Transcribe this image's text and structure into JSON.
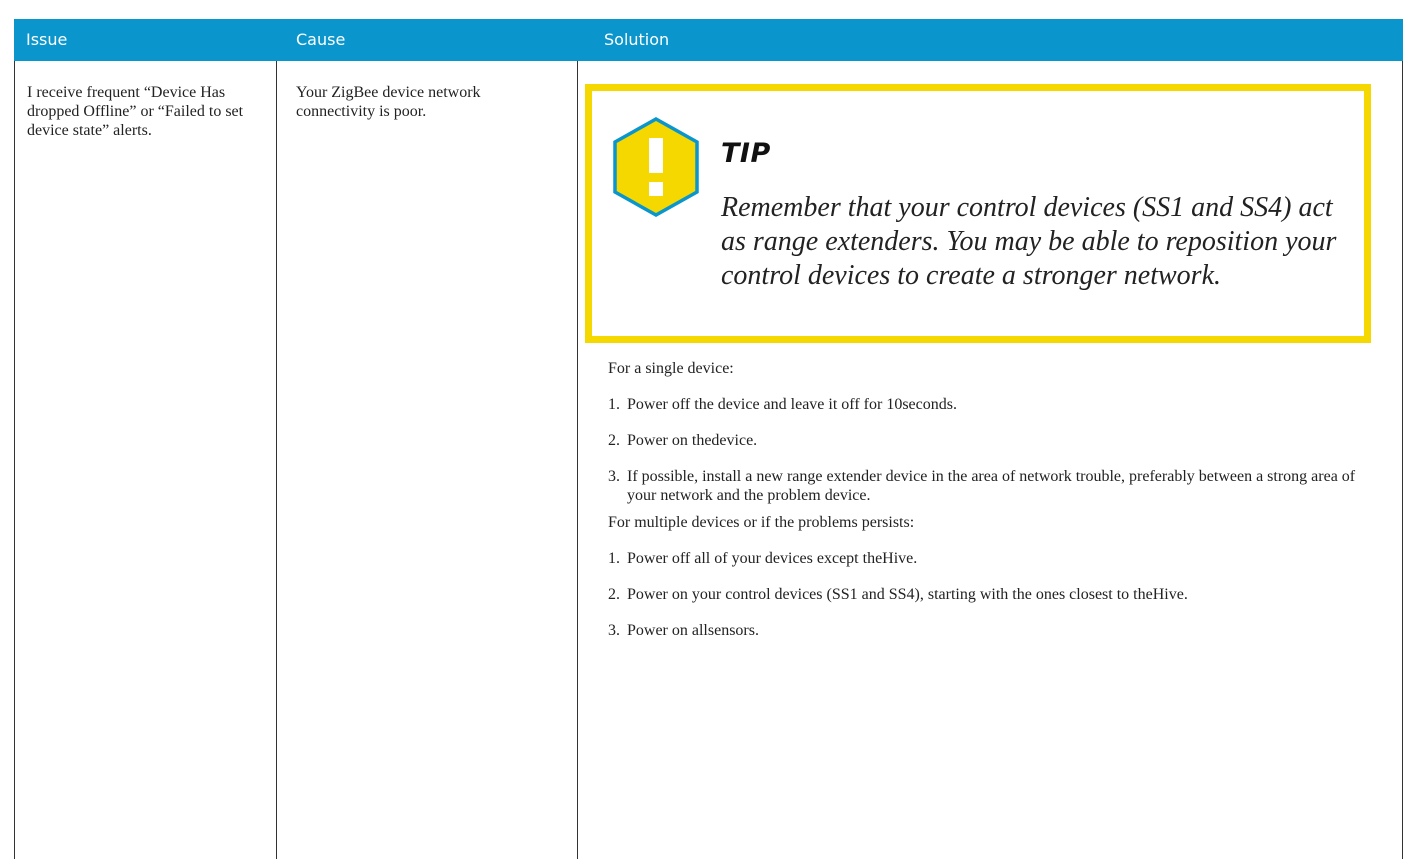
{
  "header": {
    "issue": "Issue",
    "cause": "Cause",
    "solution": "Solution"
  },
  "row": {
    "issue": "I receive frequent “Device Has dropped Offline” or “Failed to set device state” alerts.",
    "cause": "Your ZigBee device network connectivity is poor.",
    "tip": {
      "icon": "warning-hexagon-icon",
      "title": "TIP",
      "text": "Remember that your control devices (SS1 and SS4) act as range extenders. You may be able to reposition your control devices to create a stronger network."
    },
    "single": {
      "intro": "For a single device:",
      "steps": [
        {
          "num": "1.",
          "text": "Power off the device and leave it off for 10seconds."
        },
        {
          "num": "2.",
          "text": "Power on thedevice."
        },
        {
          "num": "3.",
          "text": "If possible, install a new range extender device in the area of network trouble, preferably between a strong area of your network and the problem device."
        }
      ]
    },
    "multiple": {
      "intro": "For multiple devices or if the problems persists:",
      "steps": [
        {
          "num": "1.",
          "text": "Power off all of your devices except theHive."
        },
        {
          "num": "2.",
          "text": "Power on your control devices (SS1 and SS4), starting with the ones closest to theHive."
        },
        {
          "num": "3.",
          "text": "Power on allsensors."
        }
      ]
    }
  },
  "colors": {
    "header_bg": "#0a96cc",
    "tip_border": "#f5d800",
    "tip_icon_fill": "#f5d800",
    "tip_icon_stroke": "#0a96cc"
  }
}
